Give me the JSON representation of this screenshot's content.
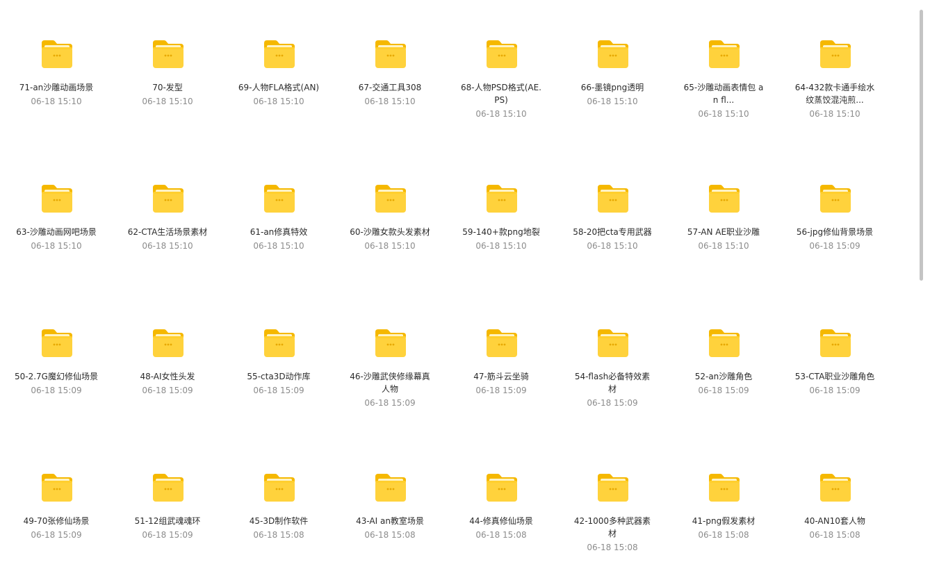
{
  "folders": [
    {
      "name": "71-an沙雕动画场景",
      "date": "06-18 15:10"
    },
    {
      "name": "70-发型",
      "date": "06-18 15:10"
    },
    {
      "name": "69-人物FLA格式(AN)",
      "date": "06-18 15:10"
    },
    {
      "name": "67-交通工具308",
      "date": "06-18 15:10"
    },
    {
      "name": "68-人物PSD格式(AE.PS)",
      "date": "06-18 15:10"
    },
    {
      "name": "66-墨镜png透明",
      "date": "06-18 15:10"
    },
    {
      "name": "65-沙雕动画表情包 an fl...",
      "date": "06-18 15:10"
    },
    {
      "name": "64-432款卡通手绘水纹蒸饺混沌煎...",
      "date": "06-18 15:10"
    },
    {
      "name": "63-沙雕动画网吧场景",
      "date": "06-18 15:10"
    },
    {
      "name": "62-CTA生活场景素材",
      "date": "06-18 15:10"
    },
    {
      "name": "61-an修真特效",
      "date": "06-18 15:10"
    },
    {
      "name": "60-沙雕女款头发素材",
      "date": "06-18 15:10"
    },
    {
      "name": "59-140+款png地裂",
      "date": "06-18 15:10"
    },
    {
      "name": "58-20把cta专用武器",
      "date": "06-18 15:10"
    },
    {
      "name": "57-AN AE职业沙雕",
      "date": "06-18 15:10"
    },
    {
      "name": "56-jpg修仙背景场景",
      "date": "06-18 15:09"
    },
    {
      "name": "50-2.7G魔幻修仙场景",
      "date": "06-18 15:09"
    },
    {
      "name": "48-AI女性头发",
      "date": "06-18 15:09"
    },
    {
      "name": "55-cta3D动作库",
      "date": "06-18 15:09"
    },
    {
      "name": "46-沙雕武侠修缘幕真人物",
      "date": "06-18 15:09"
    },
    {
      "name": "47-筋斗云坐骑",
      "date": "06-18 15:09"
    },
    {
      "name": "54-flash必备特效素材",
      "date": "06-18 15:09"
    },
    {
      "name": "52-an沙雕角色",
      "date": "06-18 15:09"
    },
    {
      "name": "53-CTA职业沙雕角色",
      "date": "06-18 15:09"
    },
    {
      "name": "49-70张修仙场景",
      "date": "06-18 15:09"
    },
    {
      "name": "51-12组武魂魂环",
      "date": "06-18 15:09"
    },
    {
      "name": "45-3D制作软件",
      "date": "06-18 15:08"
    },
    {
      "name": "43-AI an教室场景",
      "date": "06-18 15:08"
    },
    {
      "name": "44-修真修仙场景",
      "date": "06-18 15:08"
    },
    {
      "name": "42-1000多种武器素材",
      "date": "06-18 15:08"
    },
    {
      "name": "41-png假发素材",
      "date": "06-18 15:08"
    },
    {
      "name": "40-AN10套人物",
      "date": "06-18 15:08"
    }
  ],
  "icon": "folder-icon",
  "colors": {
    "folder_back": "#f5b800",
    "folder_front": "#ffd23c",
    "folder_shadow": "#ffcf2e",
    "folder_dots": "#e6a800",
    "name_text": "#2b2b2b",
    "date_text": "#8c8c8c",
    "scroll_thumb": "#c4c4c4"
  }
}
